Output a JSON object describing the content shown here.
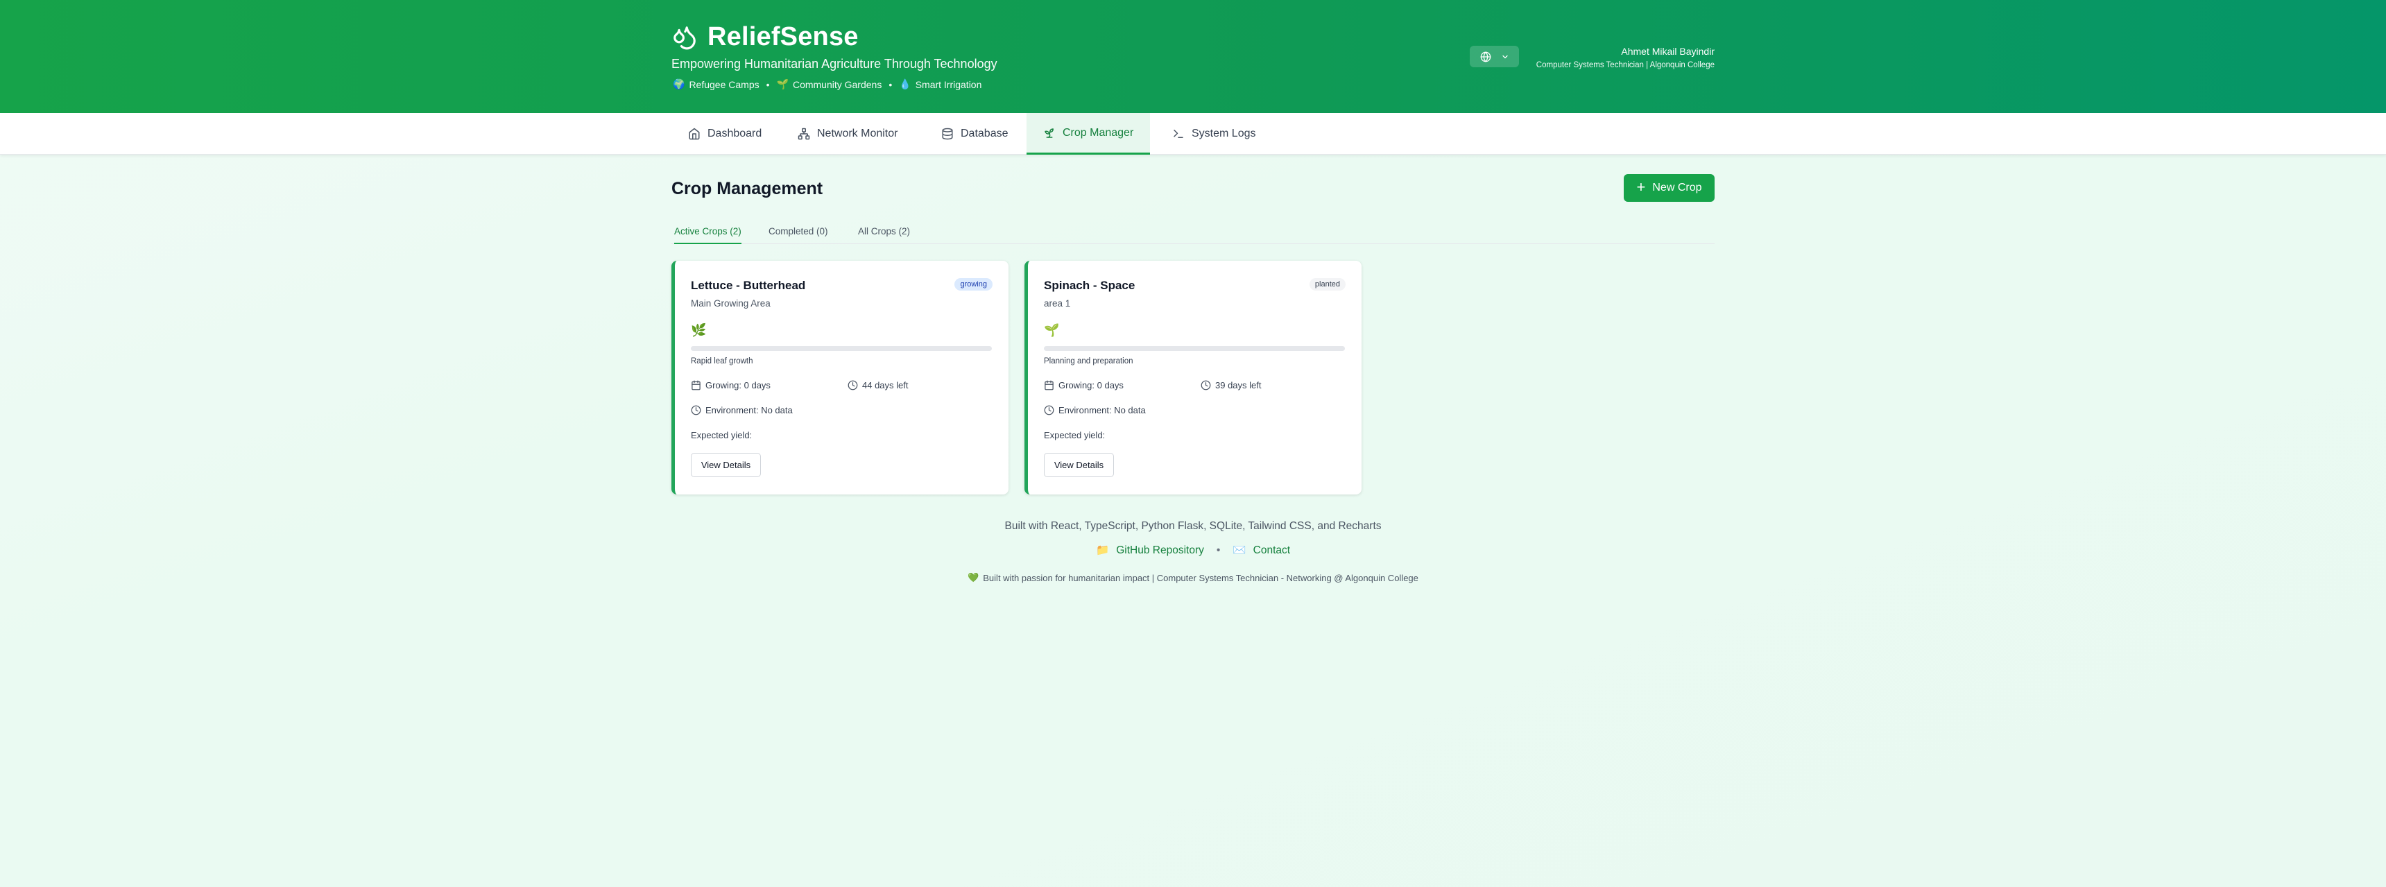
{
  "header": {
    "title": "ReliefSense",
    "tagline": "Empowering Humanitarian Agriculture Through Technology",
    "sub_tags": [
      {
        "icon": "🌍",
        "label": "Refugee Camps"
      },
      {
        "icon": "🌱",
        "label": "Community Gardens"
      },
      {
        "icon": "💧",
        "label": "Smart Irrigation"
      }
    ],
    "user_name": "Ahmet Mikail Bayindir",
    "user_role": "Computer Systems Technician | Algonquin College"
  },
  "nav": {
    "items": [
      {
        "label": "Dashboard",
        "icon": "home-icon"
      },
      {
        "label": "Network Monitor",
        "icon": "network-icon"
      },
      {
        "label": "Database",
        "icon": "database-icon"
      },
      {
        "label": "Crop Manager",
        "icon": "sprout-icon",
        "active": true
      },
      {
        "label": "System Logs",
        "icon": "terminal-icon"
      }
    ]
  },
  "main": {
    "title": "Crop Management",
    "new_crop_label": "New Crop",
    "tabs": [
      {
        "label": "Active Crops (2)",
        "active": true
      },
      {
        "label": "Completed (0)"
      },
      {
        "label": "All Crops (2)"
      }
    ],
    "crops": [
      {
        "name": "Lettuce - Butterhead",
        "location": "Main Growing Area",
        "status": "growing",
        "stage_icon": "🌿",
        "progress": 0,
        "stage": "Rapid leaf growth",
        "growing": "Growing: 0 days",
        "days_left": "44 days left",
        "environment": "Environment: No data",
        "expected_yield": "Expected yield:",
        "details_label": "View Details"
      },
      {
        "name": "Spinach - Space",
        "location": "area 1",
        "status": "planted",
        "stage_icon": "🌱",
        "progress": 0,
        "stage": "Planning and preparation",
        "growing": "Growing: 0 days",
        "days_left": "39 days left",
        "environment": "Environment: No data",
        "expected_yield": "Expected yield:",
        "details_label": "View Details"
      }
    ]
  },
  "footer": {
    "tech": "Built with React, TypeScript, Python Flask, SQLite, Tailwind CSS, and Recharts",
    "github_icon": "📁",
    "github": "GitHub Repository",
    "separator": "•",
    "contact_icon": "✉️",
    "contact": "Contact",
    "heart_icon": "💚",
    "credit": "Built with passion for humanitarian impact | Computer Systems Technician - Networking @ Algonquin College"
  },
  "colors": {
    "brand": "#16a34a",
    "accent_dark": "#15803d",
    "growing_badge": "#dbeafe",
    "planted_badge": "#f3f4f6"
  }
}
